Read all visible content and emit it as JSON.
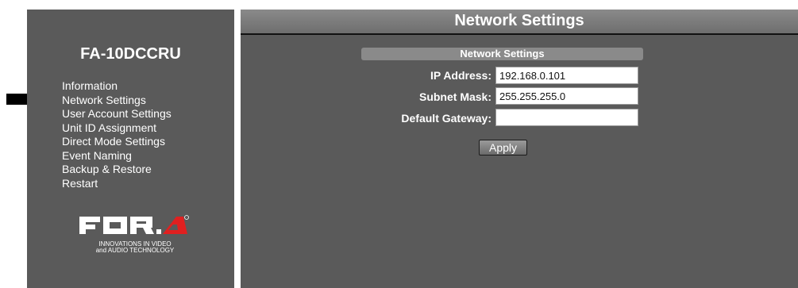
{
  "sidebar": {
    "model": "FA-10DCCRU",
    "items": [
      {
        "label": "Information"
      },
      {
        "label": "Network Settings"
      },
      {
        "label": "User Account Settings"
      },
      {
        "label": "Unit ID Assignment"
      },
      {
        "label": "Direct Mode Settings"
      },
      {
        "label": "Event Naming"
      },
      {
        "label": "Backup & Restore"
      },
      {
        "label": "Restart"
      }
    ],
    "logo": {
      "text": "FOR.A",
      "tagline_1": "INNOVATIONS IN VIDEO",
      "tagline_2": "and AUDIO TECHNOLOGY"
    },
    "pointer_icon": "arrow-right-icon"
  },
  "main": {
    "header_title": "Network Settings",
    "panel_title": "Network Settings",
    "fields": {
      "ip_address": {
        "label": "IP Address:",
        "value": "192.168.0.101"
      },
      "subnet_mask": {
        "label": "Subnet Mask:",
        "value": "255.255.255.0"
      },
      "default_gateway": {
        "label": "Default Gateway:",
        "value": ""
      }
    },
    "apply_label": "Apply"
  },
  "colors": {
    "panel_bg": "#5a5a5a",
    "header_bg": "#7c7c7c",
    "text": "#ffffff",
    "arrow": "#000000"
  }
}
